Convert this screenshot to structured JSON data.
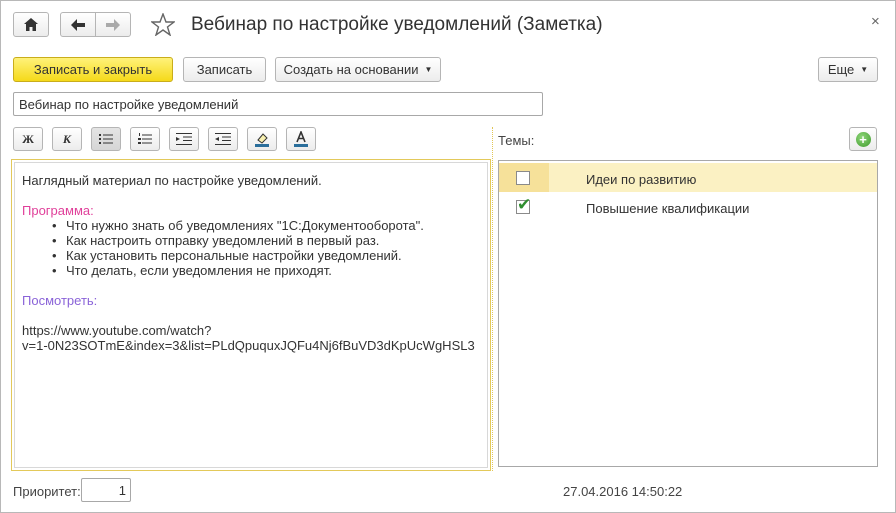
{
  "window": {
    "title": "Вебинар по настройке уведомлений (Заметка)"
  },
  "nav": {
    "home_icon": "home-icon",
    "back_icon": "arrow-left-icon",
    "forward_icon": "arrow-right-icon",
    "favorite_icon": "star-icon",
    "close_glyph": "×"
  },
  "toolbar": {
    "save_close_label": "Записать и закрыть",
    "save_label": "Записать",
    "create_based_label": "Создать на основании",
    "more_label": "Еще"
  },
  "form": {
    "name_value": "Вебинар по настройке уведомлений",
    "priority_label": "Приоритет:",
    "priority_value": "1",
    "timestamp": "27.04.2016 14:50:22"
  },
  "format_toolbar": [
    {
      "name": "bold-button",
      "glyph": "Ж"
    },
    {
      "name": "italic-button",
      "glyph": "К"
    },
    {
      "name": "bullet-list-button",
      "icon": "bullet-list-icon"
    },
    {
      "name": "numbered-list-button",
      "icon": "numbered-list-icon"
    },
    {
      "name": "indent-button",
      "icon": "indent-icon"
    },
    {
      "name": "outdent-button",
      "icon": "outdent-icon"
    },
    {
      "name": "highlight-button",
      "icon": "highlight-icon"
    },
    {
      "name": "text-color-button",
      "icon": "text-color-icon"
    }
  ],
  "editor": {
    "intro": "Наглядный материал по настройке уведомлений.",
    "program_heading": "Программа:",
    "program_items": [
      "Что нужно знать об уведомлениях \"1С:Документооборота\".",
      "Как настроить отправку уведомлений в первый раз.",
      "Как установить персональные настройки уведомлений.",
      "Что делать, если уведомления не приходят."
    ],
    "watch_heading": "Посмотреть:",
    "url_line1": "https://www.youtube.com/watch?",
    "url_line2": "v=1-0N23SOTmE&index=3&list=PLdQpuquxJQFu4Nj6fBuVD3dKpUcWgHSL3"
  },
  "themes": {
    "label": "Темы:",
    "add_icon": "add-icon",
    "items": [
      {
        "label": "Идеи по развитию",
        "checked": false
      },
      {
        "label": "Повышение квалификации",
        "checked": true
      }
    ]
  },
  "colors": {
    "primary_button": "#f5d91a",
    "program_heading": "#e0409a",
    "watch_heading": "#8a63d8",
    "selected_row": "#fbf1c3",
    "check": "#2f8e2f"
  }
}
